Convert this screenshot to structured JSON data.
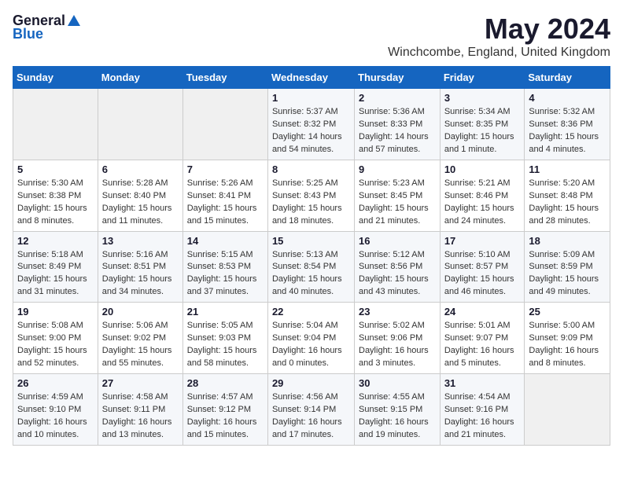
{
  "logo": {
    "general": "General",
    "blue": "Blue"
  },
  "title": "May 2024",
  "subtitle": "Winchcombe, England, United Kingdom",
  "headers": [
    "Sunday",
    "Monday",
    "Tuesday",
    "Wednesday",
    "Thursday",
    "Friday",
    "Saturday"
  ],
  "weeks": [
    [
      {
        "day": "",
        "info": ""
      },
      {
        "day": "",
        "info": ""
      },
      {
        "day": "",
        "info": ""
      },
      {
        "day": "1",
        "info": "Sunrise: 5:37 AM\nSunset: 8:32 PM\nDaylight: 14 hours\nand 54 minutes."
      },
      {
        "day": "2",
        "info": "Sunrise: 5:36 AM\nSunset: 8:33 PM\nDaylight: 14 hours\nand 57 minutes."
      },
      {
        "day": "3",
        "info": "Sunrise: 5:34 AM\nSunset: 8:35 PM\nDaylight: 15 hours\nand 1 minute."
      },
      {
        "day": "4",
        "info": "Sunrise: 5:32 AM\nSunset: 8:36 PM\nDaylight: 15 hours\nand 4 minutes."
      }
    ],
    [
      {
        "day": "5",
        "info": "Sunrise: 5:30 AM\nSunset: 8:38 PM\nDaylight: 15 hours\nand 8 minutes."
      },
      {
        "day": "6",
        "info": "Sunrise: 5:28 AM\nSunset: 8:40 PM\nDaylight: 15 hours\nand 11 minutes."
      },
      {
        "day": "7",
        "info": "Sunrise: 5:26 AM\nSunset: 8:41 PM\nDaylight: 15 hours\nand 15 minutes."
      },
      {
        "day": "8",
        "info": "Sunrise: 5:25 AM\nSunset: 8:43 PM\nDaylight: 15 hours\nand 18 minutes."
      },
      {
        "day": "9",
        "info": "Sunrise: 5:23 AM\nSunset: 8:45 PM\nDaylight: 15 hours\nand 21 minutes."
      },
      {
        "day": "10",
        "info": "Sunrise: 5:21 AM\nSunset: 8:46 PM\nDaylight: 15 hours\nand 24 minutes."
      },
      {
        "day": "11",
        "info": "Sunrise: 5:20 AM\nSunset: 8:48 PM\nDaylight: 15 hours\nand 28 minutes."
      }
    ],
    [
      {
        "day": "12",
        "info": "Sunrise: 5:18 AM\nSunset: 8:49 PM\nDaylight: 15 hours\nand 31 minutes."
      },
      {
        "day": "13",
        "info": "Sunrise: 5:16 AM\nSunset: 8:51 PM\nDaylight: 15 hours\nand 34 minutes."
      },
      {
        "day": "14",
        "info": "Sunrise: 5:15 AM\nSunset: 8:53 PM\nDaylight: 15 hours\nand 37 minutes."
      },
      {
        "day": "15",
        "info": "Sunrise: 5:13 AM\nSunset: 8:54 PM\nDaylight: 15 hours\nand 40 minutes."
      },
      {
        "day": "16",
        "info": "Sunrise: 5:12 AM\nSunset: 8:56 PM\nDaylight: 15 hours\nand 43 minutes."
      },
      {
        "day": "17",
        "info": "Sunrise: 5:10 AM\nSunset: 8:57 PM\nDaylight: 15 hours\nand 46 minutes."
      },
      {
        "day": "18",
        "info": "Sunrise: 5:09 AM\nSunset: 8:59 PM\nDaylight: 15 hours\nand 49 minutes."
      }
    ],
    [
      {
        "day": "19",
        "info": "Sunrise: 5:08 AM\nSunset: 9:00 PM\nDaylight: 15 hours\nand 52 minutes."
      },
      {
        "day": "20",
        "info": "Sunrise: 5:06 AM\nSunset: 9:02 PM\nDaylight: 15 hours\nand 55 minutes."
      },
      {
        "day": "21",
        "info": "Sunrise: 5:05 AM\nSunset: 9:03 PM\nDaylight: 15 hours\nand 58 minutes."
      },
      {
        "day": "22",
        "info": "Sunrise: 5:04 AM\nSunset: 9:04 PM\nDaylight: 16 hours\nand 0 minutes."
      },
      {
        "day": "23",
        "info": "Sunrise: 5:02 AM\nSunset: 9:06 PM\nDaylight: 16 hours\nand 3 minutes."
      },
      {
        "day": "24",
        "info": "Sunrise: 5:01 AM\nSunset: 9:07 PM\nDaylight: 16 hours\nand 5 minutes."
      },
      {
        "day": "25",
        "info": "Sunrise: 5:00 AM\nSunset: 9:09 PM\nDaylight: 16 hours\nand 8 minutes."
      }
    ],
    [
      {
        "day": "26",
        "info": "Sunrise: 4:59 AM\nSunset: 9:10 PM\nDaylight: 16 hours\nand 10 minutes."
      },
      {
        "day": "27",
        "info": "Sunrise: 4:58 AM\nSunset: 9:11 PM\nDaylight: 16 hours\nand 13 minutes."
      },
      {
        "day": "28",
        "info": "Sunrise: 4:57 AM\nSunset: 9:12 PM\nDaylight: 16 hours\nand 15 minutes."
      },
      {
        "day": "29",
        "info": "Sunrise: 4:56 AM\nSunset: 9:14 PM\nDaylight: 16 hours\nand 17 minutes."
      },
      {
        "day": "30",
        "info": "Sunrise: 4:55 AM\nSunset: 9:15 PM\nDaylight: 16 hours\nand 19 minutes."
      },
      {
        "day": "31",
        "info": "Sunrise: 4:54 AM\nSunset: 9:16 PM\nDaylight: 16 hours\nand 21 minutes."
      },
      {
        "day": "",
        "info": ""
      }
    ]
  ]
}
